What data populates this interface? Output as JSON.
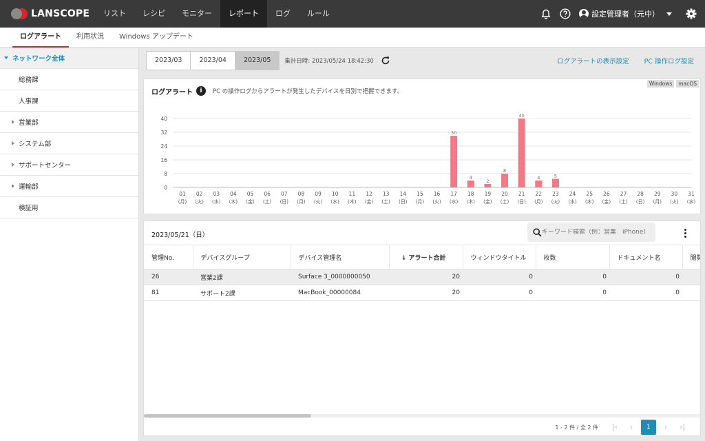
{
  "header": {
    "logo": "LANSCOPE",
    "nav": [
      "リスト",
      "レシピ",
      "モニター",
      "レポート",
      "ログ",
      "ルール"
    ],
    "active_nav": "レポート",
    "user": "設定管理者（元中）",
    "icons": [
      "bell-icon",
      "help-icon",
      "user-icon",
      "gear-icon"
    ]
  },
  "subtabs": [
    "ログアラート",
    "利用状況",
    "Windows アップデート"
  ],
  "active_subtab": "ログアラート",
  "sidebar": {
    "items": [
      {
        "label": "ネットワーク全体",
        "expandable": true,
        "root": true
      },
      {
        "label": "総務課",
        "expandable": false
      },
      {
        "label": "人事課",
        "expandable": false
      },
      {
        "label": "営業部",
        "expandable": true
      },
      {
        "label": "システム部",
        "expandable": true
      },
      {
        "label": "サポートセンター",
        "expandable": true
      },
      {
        "label": "運輸部",
        "expandable": true
      },
      {
        "label": "検証用",
        "expandable": false
      }
    ]
  },
  "toolbar": {
    "months": [
      "2023/03",
      "2023/04",
      "2023/05"
    ],
    "selected_month": "2023/05",
    "aggregate_time": "集計日時: 2023/05/24 18:42:30",
    "link_display_settings": "ログアラートの表示設定",
    "link_pc_log_settings": "PC 操作ログ設定"
  },
  "card": {
    "title": "ログアラート",
    "description": "PC の操作ログからアラートが発生したデバイスを日別で把握できます。",
    "os_tags": [
      "Windows",
      "macOS"
    ]
  },
  "chart_data": {
    "type": "bar",
    "color": "#f07b86",
    "ylim": [
      0,
      40
    ],
    "yticks": [
      0,
      8,
      16,
      24,
      32,
      40
    ],
    "categories": [
      "01",
      "02",
      "03",
      "04",
      "05",
      "06",
      "07",
      "08",
      "09",
      "10",
      "11",
      "12",
      "13",
      "14",
      "15",
      "16",
      "17",
      "18",
      "19",
      "20",
      "21",
      "22",
      "23",
      "24",
      "25",
      "26",
      "27",
      "28",
      "29",
      "30",
      "31"
    ],
    "weekdays": [
      "(月)",
      "(火)",
      "(水)",
      "(木)",
      "(金)",
      "(土)",
      "(日)",
      "(月)",
      "(火)",
      "(水)",
      "(木)",
      "(金)",
      "(土)",
      "(日)",
      "(月)",
      "(火)",
      "(水)",
      "(木)",
      "(金)",
      "(土)",
      "(日)",
      "(月)",
      "(火)",
      "(水)",
      "(木)",
      "(金)",
      "(土)",
      "(日)",
      "(月)",
      "(火)",
      "(水)"
    ],
    "values": [
      0,
      0,
      0,
      0,
      0,
      0,
      0,
      0,
      0,
      0,
      0,
      0,
      0,
      0,
      0,
      0,
      30,
      4,
      2,
      8,
      40,
      4,
      5,
      0,
      0,
      0,
      0,
      0,
      0,
      0,
      0
    ]
  },
  "table": {
    "date": "2023/05/21（日）",
    "search_placeholder": "キーワード検索（例：営業　iPhone）",
    "columns": [
      "管理No.",
      "デバイスグループ",
      "デバイス管理名",
      "アラート合計",
      "ウィンドウタイトル",
      "枚数",
      "ドキュメント名",
      "閲覧"
    ],
    "rows": [
      [
        "26",
        "営業2課",
        "Surface 3_0000000050",
        "20",
        "0",
        "0",
        "0"
      ],
      [
        "81",
        "サポート2課",
        "MacBook_00000084",
        "20",
        "0",
        "0",
        "0"
      ]
    ],
    "pager_info": "1 - 2 件 / 全 2 件",
    "current_page": "1"
  }
}
